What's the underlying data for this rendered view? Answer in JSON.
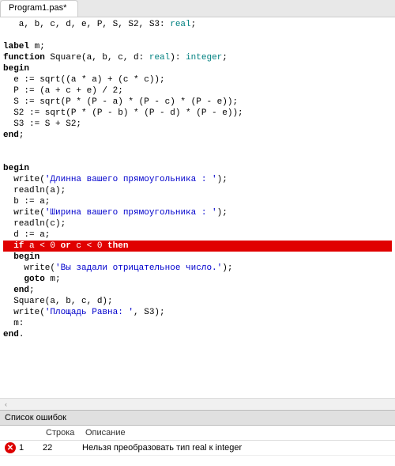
{
  "tab": {
    "title": "Program1.pas*"
  },
  "code": {
    "l1": "   a, b, c, d, e, P, S, S2, S3: ",
    "l1t": "real",
    "l1e": ";",
    "l2": "",
    "l3a": "label",
    "l3b": " m;",
    "l4a": "function",
    "l4b": " Square(a, b, c, d: ",
    "l4t": "real",
    "l4c": "): ",
    "l4t2": "integer",
    "l4d": ";",
    "l5": "begin",
    "l6": "  e := sqrt((a * a) + (c * c));",
    "l7": "  P := (a + c + e) / 2;",
    "l8": "  S := sqrt(P * (P - a) * (P - c) * (P - e));",
    "l9": "  S2 := sqrt(P * (P - b) * (P - d) * (P - e));",
    "l10": "  S3 := S + S2;",
    "l11": "end",
    "l11e": ";",
    "l12": "",
    "l13": "",
    "l14": "begin",
    "l15a": "  write(",
    "l15s": "'Длинна вашего прямоугольника : '",
    "l15b": ");",
    "l16": "  readln(a);",
    "l17": "  b := a;",
    "l18a": "  write(",
    "l18s": "'Ширина вашего прямоугольника : '",
    "l18b": ");",
    "l19": "  readln(c);",
    "l20": "  d := a;",
    "l21a": "  if",
    "l21b": " a < 0 ",
    "l21c": "or",
    "l21d": " c < 0 ",
    "l21e": "then",
    "l22": "  begin",
    "l23a": "    write(",
    "l23s": "'Вы задали отрицательное число.'",
    "l23b": ");",
    "l24a": "    ",
    "l24b": "goto",
    "l24c": " m;",
    "l25": "  end",
    "l25e": ";",
    "l26": "  Square(a, b, c, d);",
    "l27a": "  write(",
    "l27s": "'Площадь Равна: '",
    "l27b": ", S3);",
    "l28": "  m:",
    "l29": "end",
    "l29e": "."
  },
  "errors": {
    "panel_title": "Список ошибок",
    "col_line": "Строка",
    "col_desc": "Описание",
    "row": {
      "line": "1",
      "col": "22",
      "desc": "Нельзя преобразовать тип real к integer"
    }
  },
  "scroll": {
    "left": "‹"
  }
}
